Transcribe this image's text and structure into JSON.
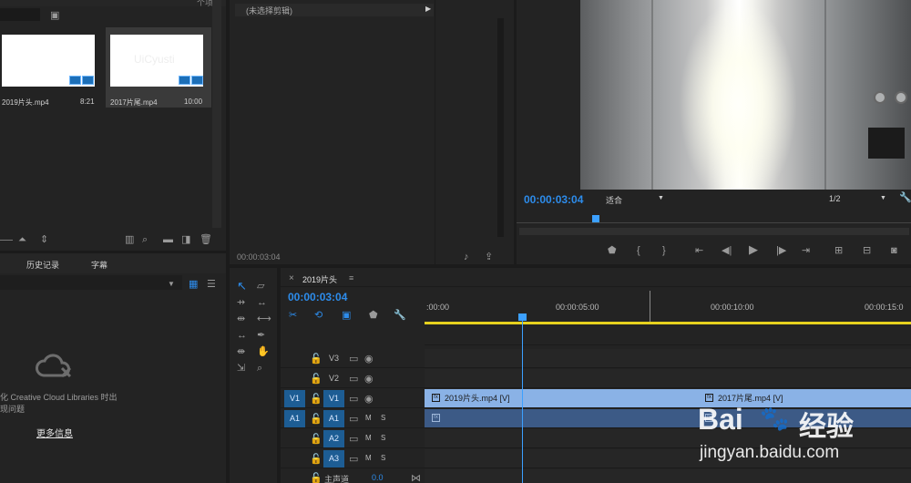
{
  "project": {
    "header_text": "个项",
    "clips": [
      {
        "name": "2019片头.mp4",
        "duration": "8:21"
      },
      {
        "name": "2017片尾.mp4",
        "duration": "10:00"
      }
    ],
    "thumb_watermark": "UiCyusti"
  },
  "libraries": {
    "tabs": [
      "历史记录",
      "字幕"
    ],
    "message_line1": "化 Creative Cloud Libraries 时出",
    "message_line2": "现问题",
    "more_info": "更多信息"
  },
  "effects": {
    "header": "(未选择剪辑)",
    "timecode": "00:00:03:04"
  },
  "program": {
    "timecode": "00:00:03:04",
    "zoom": "适合",
    "resolution": "1/2"
  },
  "timeline": {
    "sequence_name": "2019片头",
    "timecode": "00:00:03:04",
    "ruler": [
      ":00:00",
      "00:00:05:00",
      "00:00:10:00",
      "00:00:15:0"
    ],
    "tracks": [
      {
        "source": "",
        "label": "V3",
        "kind": "video"
      },
      {
        "source": "",
        "label": "V2",
        "kind": "video"
      },
      {
        "source": "V1",
        "label": "V1",
        "kind": "video"
      },
      {
        "source": "A1",
        "label": "A1",
        "kind": "audio"
      },
      {
        "source": "",
        "label": "A2",
        "kind": "audio"
      },
      {
        "source": "",
        "label": "A3",
        "kind": "audio"
      }
    ],
    "master_label": "主声道",
    "master_value": "0.0",
    "mute_label": "M",
    "solo_label": "S",
    "video_clips": [
      "2019片头.mp4 [V]",
      "2017片尾.mp4 [V]"
    ]
  },
  "watermark": {
    "brand_left": "Bai",
    "brand_right": "经验",
    "url": "jingyan.baidu.com"
  },
  "colors": {
    "accent": "#2d8ceb",
    "playhead": "#3ca0ff",
    "video_clip": "#8ab2e6",
    "audio_clip": "#3c5a86",
    "work_area": "#e6d11e"
  }
}
